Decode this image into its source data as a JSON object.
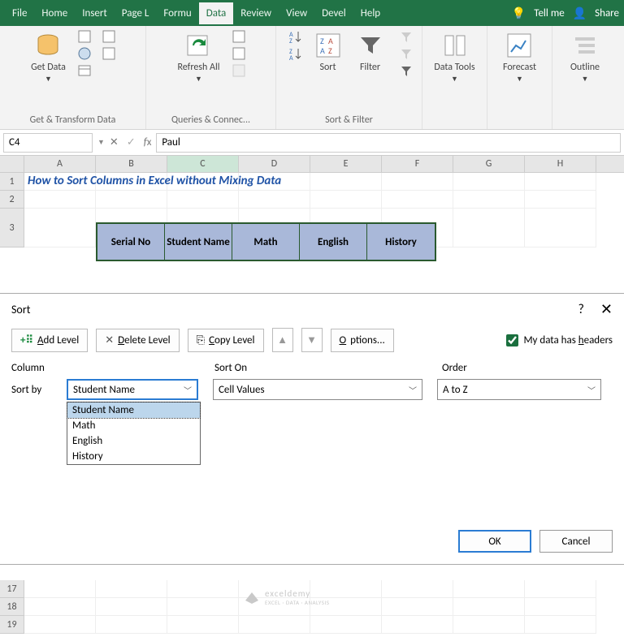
{
  "titlebar": {
    "tabs": [
      "File",
      "Home",
      "Insert",
      "Page L",
      "Formu",
      "Data",
      "Review",
      "View",
      "Devel",
      "Help"
    ],
    "active": "Data",
    "tellme": "Tell me",
    "share": "Share"
  },
  "ribbon": {
    "getdata": "Get Data",
    "group1": "Get & Transform Data",
    "refresh": "Refresh All",
    "group2": "Queries & Connec...",
    "sort": "Sort",
    "filter": "Filter",
    "group3": "Sort & Filter",
    "datatools": "Data Tools",
    "forecast": "Forecast",
    "outline": "Outline"
  },
  "formula": {
    "namebox": "C4",
    "value": "Paul"
  },
  "sheet": {
    "cols": [
      "A",
      "B",
      "C",
      "D",
      "E",
      "F",
      "G",
      "H"
    ],
    "title": "How to Sort Columns in Excel without Mixing Data",
    "headers": [
      "Serial No",
      "Student Name",
      "Math",
      "English",
      "History"
    ],
    "bottom_rows": [
      "17",
      "18",
      "19"
    ]
  },
  "dialog": {
    "title": "Sort",
    "add": "Add Level",
    "delete": "Delete Level",
    "copy": "Copy Level",
    "options": "Options...",
    "checkbox": "My data has headers",
    "col_h": "Column",
    "sorton_h": "Sort On",
    "order_h": "Order",
    "sortby": "Sort by",
    "sortby_val": "Student Name",
    "sorton_val": "Cell Values",
    "order_val": "A to Z",
    "options_list": [
      "Student Name",
      "Math",
      "English",
      "History"
    ],
    "ok": "OK",
    "cancel": "Cancel"
  },
  "watermark": {
    "main": "exceldemy",
    "sub": "EXCEL · DATA · ANALYSIS"
  }
}
